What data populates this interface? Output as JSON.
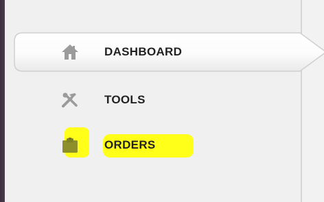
{
  "sidebar": {
    "items": [
      {
        "label": "DASHBOARD",
        "icon": "home-icon",
        "active": true
      },
      {
        "label": "TOOLS",
        "icon": "tools-icon",
        "active": false
      },
      {
        "label": "ORDERS",
        "icon": "clipboard-icon",
        "active": false,
        "highlighted": true
      }
    ]
  },
  "colors": {
    "highlight": "#ffff1a",
    "icon_gray": "#9b9b9b",
    "text": "#222222",
    "app_edge": "#3c2f3e"
  }
}
